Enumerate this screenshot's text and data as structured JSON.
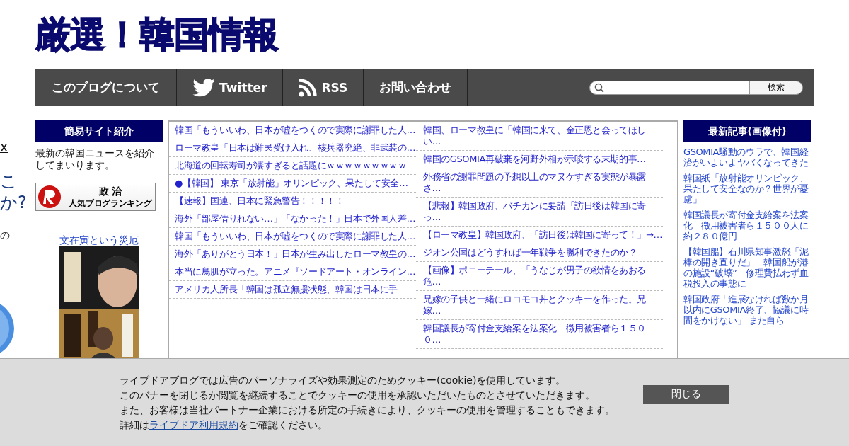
{
  "site_title": "厳選！韓国情報",
  "left_edge_fragments": [
    {
      "text": "x",
      "kind": "link"
    },
    {
      "text": "こ",
      "kind": "big"
    },
    {
      "text": "か?",
      "kind": "big"
    },
    {
      "text": "の",
      "kind": "small"
    }
  ],
  "nav": {
    "items": [
      {
        "label": "このブログについて",
        "kind": "text"
      },
      {
        "label": "Twitter",
        "kind": "twitter"
      },
      {
        "label": "RSS",
        "kind": "rss"
      },
      {
        "label": "お問い合わせ",
        "kind": "text"
      }
    ],
    "search": {
      "button": "検索"
    }
  },
  "left_sidebar": {
    "heading": "簡易サイト紹介",
    "intro": "最新の韓国ニュースを紹介してまいります。",
    "ranking": {
      "title": "政 治",
      "subtitle": "人気ブログランキング"
    },
    "book": {
      "title": "文在寅という災厄",
      "kind": "picture"
    }
  },
  "article_columns": [
    [
      "韓国「もういいわ、日本が嘘をつくので実際に謝罪した人…",
      "ローマ教皇「日本は難民受け入れ、核兵器廃絶、非武装の…",
      "北海道の回転寿司が凄すぎると話題にｗｗｗｗｗｗｗｗｗ",
      "●【韓国】 東京「放射能」オリンピック、果たして安全…",
      "【速報】国連、日本に緊急警告！！！！！",
      "海外「部屋借りれない…」「なかった！」日本で外国人差…",
      "韓国「もういいわ、日本が嘘をつくので実際に謝罪した人…",
      "海外「ありがとう日本！」日本が生み出したローマ教皇の…",
      "本当に鳥肌が立った。アニメ『ソードアート・オンライン…",
      "アメリカ人所長「韓国は孤立無援状態、韓国は日本に手"
    ],
    [
      "韓国、ローマ教皇に「韓国に来て、金正恩と会ってほしい…",
      "韓国のGSOMIA再破棄を河野外相が示唆する末期的事…",
      "外務省の謝罪問題の予想以上のマヌケすぎる実態が暴露さ…",
      "【悲報】韓国政府、バチカンに要請「訪日後は韓国に寄っ…",
      "【ローマ教皇】韓国政府、「訪日後は韓国に寄って！」→…",
      "ジオン公国はどうすれば一年戦争を勝利できたのか？",
      "【画像】ポニーテール、「うなじが男子の欲情をあおる危…",
      "兄嫁の子供と一緒にロコモコ丼とクッキーを作った。兄嫁…",
      "韓国議長が寄付金支給案を法案化　徴用被害者ら１５００…"
    ]
  ],
  "right_sidebar": {
    "heading": "最新記事(画像付)",
    "items": [
      "GSOMIA騒動のウラで、韓国経済がいよいよヤバくなってきた",
      "韓国紙「放射能オリンピック、果たして安全なのか？世界が憂慮」",
      "韓国議長が寄付金支給案を法案化　徴用被害者ら１５００人に約２８０億円",
      "【韓国船】石川県知事激怒「泥棒の開き直りだ」　韓国船が港の施設“破壊”　修理費払わず血税投入の事態に",
      "韓国政府「進展なければ数か月以内にGSOMIA終了、協議に時間をかけない」 また自ら"
    ]
  },
  "cookie_banner": {
    "lines": [
      "ライブドアブログでは広告のパーソナライズや効果測定のためクッキー(cookie)を使用しています。",
      "このバナーを閉じるか閲覧を継続することでクッキーの使用を承認いただいたものとさせていただきます。",
      "また、お客様は当社パートナー企業における所定の手続きにより、クッキーの使用を管理することもできます。"
    ],
    "last_line": {
      "before": "詳細は",
      "link": "ライブドア利用規約",
      "after": "をご確認ください。"
    },
    "close_button": "閉じる"
  }
}
